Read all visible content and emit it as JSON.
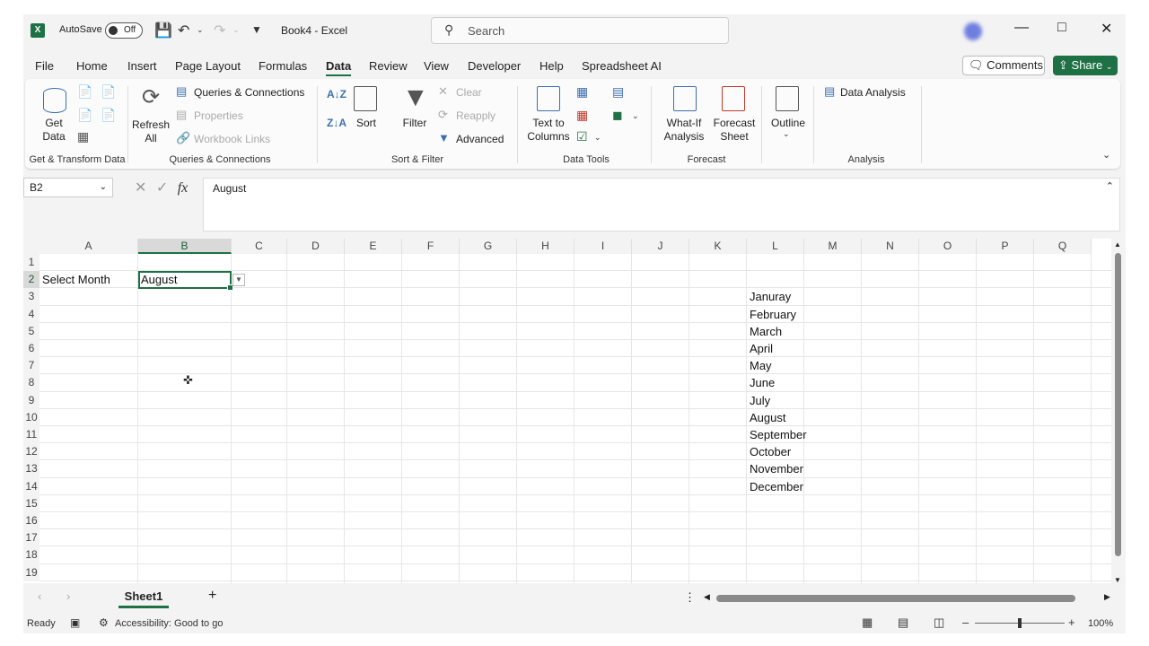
{
  "app": {
    "autosave_label": "AutoSave",
    "autosave_state": "Off",
    "doc_title": "Book4  -  Excel",
    "search_placeholder": "Search"
  },
  "menu": {
    "items": [
      "File",
      "Home",
      "Insert",
      "Page Layout",
      "Formulas",
      "Data",
      "Review",
      "View",
      "Developer",
      "Help",
      "Spreadsheet AI"
    ],
    "active": "Data",
    "comments_label": "Comments",
    "share_label": "Share"
  },
  "ribbon": {
    "get_data": "Get\nData",
    "refresh_all": "Refresh\nAll",
    "queries_connections": "Queries & Connections",
    "properties": "Properties",
    "workbook_links": "Workbook Links",
    "sort": "Sort",
    "filter": "Filter",
    "clear": "Clear",
    "reapply": "Reapply",
    "advanced": "Advanced",
    "text_to_columns": "Text to\nColumns",
    "what_if": "What-If\nAnalysis",
    "forecast_sheet": "Forecast\nSheet",
    "outline": "Outline",
    "data_analysis": "Data Analysis",
    "groups": {
      "get_transform": "Get & Transform Data",
      "queries": "Queries & Connections",
      "sort_filter": "Sort & Filter",
      "data_tools": "Data Tools",
      "forecast": "Forecast",
      "analysis": "Analysis"
    }
  },
  "formula_bar": {
    "name_box": "B2",
    "fx": "fx",
    "content": "August"
  },
  "grid": {
    "columns": [
      "A",
      "B",
      "C",
      "D",
      "E",
      "F",
      "G",
      "H",
      "I",
      "J",
      "K",
      "L",
      "M",
      "N",
      "O",
      "P",
      "Q"
    ],
    "rows": [
      "1",
      "2",
      "3",
      "4",
      "5",
      "6",
      "7",
      "8",
      "9",
      "10",
      "11",
      "12",
      "13",
      "14",
      "15",
      "16",
      "17",
      "18",
      "19"
    ],
    "selected_column": "B",
    "selected_row": "2",
    "a2": "Select Month",
    "b2": "August",
    "months": [
      "Januray",
      "February",
      "March",
      "April",
      "May",
      "June",
      "July",
      "August",
      "September",
      "October",
      "November",
      "December"
    ]
  },
  "sheets": {
    "active": "Sheet1",
    "add": "+"
  },
  "status": {
    "ready": "Ready",
    "accessibility": "Accessibility: Good to go",
    "zoom": "100%"
  },
  "colors": {
    "accent": "#1e7145",
    "ribbon_icon": "#3c6fb0"
  }
}
